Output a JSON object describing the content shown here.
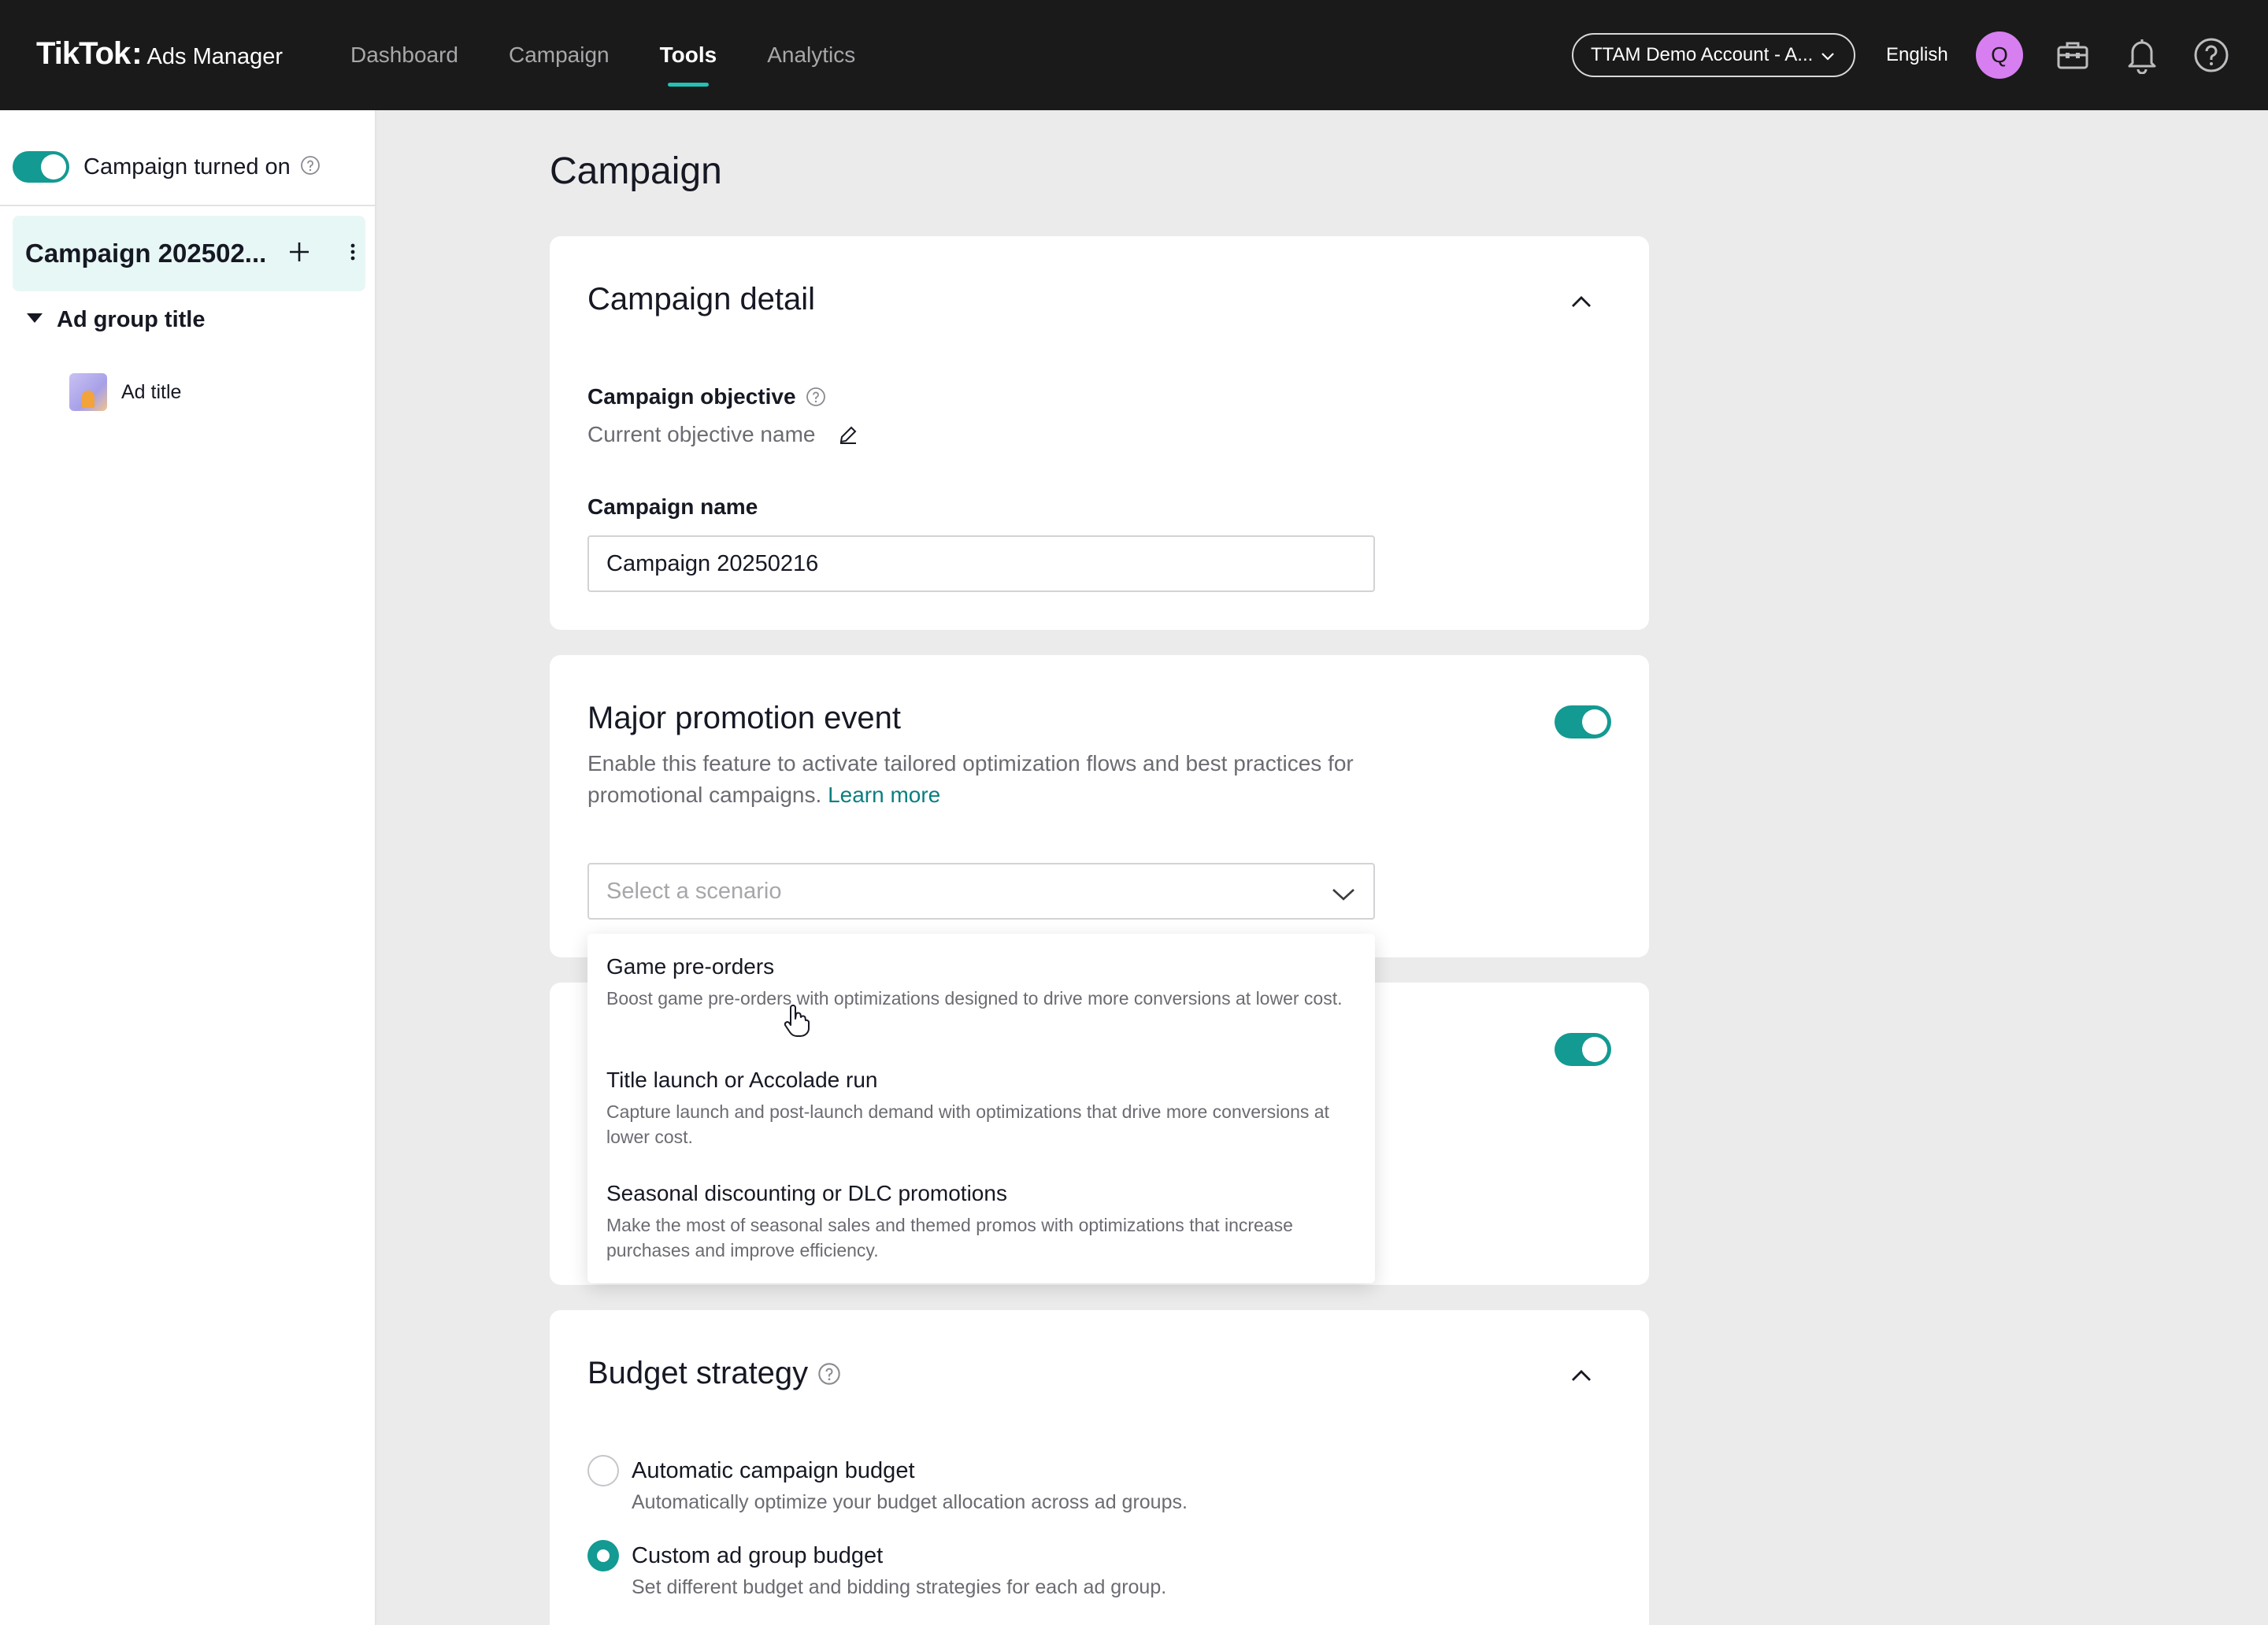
{
  "topbar": {
    "logo_main": "TikTok",
    "logo_colon": ":",
    "logo_sub": "Ads Manager",
    "nav": [
      {
        "label": "Dashboard"
      },
      {
        "label": "Campaign"
      },
      {
        "label": "Tools",
        "active": true
      },
      {
        "label": "Analytics"
      }
    ],
    "account_label": "TTAM Demo Account - A...",
    "language": "English",
    "avatar_initial": "Q",
    "icons": [
      "briefcase-icon",
      "bell-icon",
      "help-icon"
    ]
  },
  "sidebar": {
    "status_label": "Campaign turned on",
    "campaign_name": "Campaign 202502...",
    "ad_group_title": "Ad group title",
    "ad_title": "Ad title"
  },
  "main": {
    "page_title": "Campaign",
    "campaign_detail": {
      "title": "Campaign detail",
      "objective_label": "Campaign objective",
      "objective_value": "Current objective name",
      "name_label": "Campaign name",
      "name_value": "Campaign 20250216"
    },
    "promotion": {
      "title": "Major promotion event",
      "description": "Enable this feature to activate tailored optimization flows and best practices for promotional campaigns.",
      "learn_more": "Learn more",
      "select_placeholder": "Select a scenario",
      "enabled": true,
      "options": [
        {
          "title": "Game pre-orders",
          "description": "Boost game pre-orders with optimizations designed to drive more conversions at lower cost."
        },
        {
          "title": "Title launch or Accolade run",
          "description": "Capture launch and post-launch demand with optimizations that drive more conversions at lower cost."
        },
        {
          "title": "Seasonal discounting or DLC promotions",
          "description": "Make the most of seasonal sales and themed promos with optimizations that increase purchases and improve efficiency."
        }
      ]
    },
    "budget": {
      "title": "Budget strategy",
      "options": [
        {
          "title": "Automatic campaign budget",
          "description": "Automatically optimize your budget allocation across ad groups.",
          "checked": false
        },
        {
          "title": "Custom ad group budget",
          "description": "Set different budget and bidding strategies for each ad group.",
          "checked": true
        }
      ]
    }
  },
  "colors": {
    "accent": "#139a92",
    "link": "#0a7e80",
    "topbar": "#1a1a1a",
    "avatar": "#d77ff0"
  }
}
